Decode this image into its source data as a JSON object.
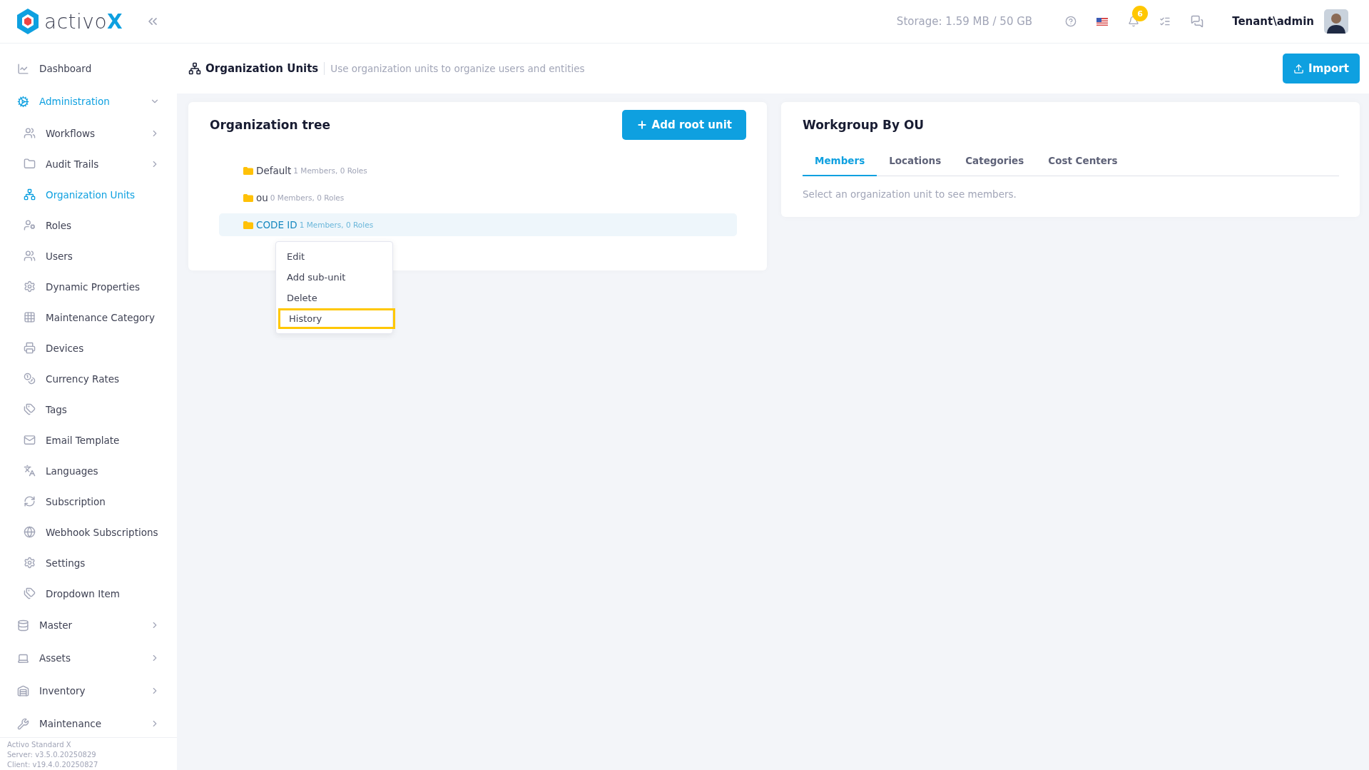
{
  "logo": {
    "word": "activo",
    "mark": "X"
  },
  "sidebar": {
    "items": [
      {
        "label": "Dashboard",
        "kind": "group",
        "selected": false
      },
      {
        "label": "Administration",
        "kind": "group",
        "selected": true,
        "expanded": true
      },
      {
        "label": "Workflows",
        "kind": "sub",
        "selected": false,
        "expanded": false
      },
      {
        "label": "Audit Trails",
        "kind": "sub",
        "selected": false,
        "expanded": false
      },
      {
        "label": "Organization Units",
        "kind": "sub",
        "selected": true
      },
      {
        "label": "Roles",
        "kind": "sub",
        "selected": false
      },
      {
        "label": "Users",
        "kind": "sub",
        "selected": false
      },
      {
        "label": "Dynamic Properties",
        "kind": "sub",
        "selected": false
      },
      {
        "label": "Maintenance Category",
        "kind": "sub",
        "selected": false
      },
      {
        "label": "Devices",
        "kind": "sub",
        "selected": false
      },
      {
        "label": "Currency Rates",
        "kind": "sub",
        "selected": false
      },
      {
        "label": "Tags",
        "kind": "sub",
        "selected": false
      },
      {
        "label": "Email Template",
        "kind": "sub",
        "selected": false
      },
      {
        "label": "Languages",
        "kind": "sub",
        "selected": false
      },
      {
        "label": "Subscription",
        "kind": "sub",
        "selected": false
      },
      {
        "label": "Webhook Subscriptions",
        "kind": "sub",
        "selected": false
      },
      {
        "label": "Settings",
        "kind": "sub",
        "selected": false
      },
      {
        "label": "Dropdown Item",
        "kind": "sub",
        "selected": false
      },
      {
        "label": "Master",
        "kind": "group",
        "selected": false,
        "expanded": false
      },
      {
        "label": "Assets",
        "kind": "group",
        "selected": false,
        "expanded": false
      },
      {
        "label": "Inventory",
        "kind": "group",
        "selected": false,
        "expanded": false
      },
      {
        "label": "Maintenance",
        "kind": "group",
        "selected": false,
        "expanded": false
      }
    ],
    "footer": [
      "Activo Standard X",
      "Server: v3.5.0.20250829",
      "Client: v19.4.0.20250827"
    ]
  },
  "header": {
    "storage": "Storage: 1.59 MB / 50 GB",
    "notification_count": "6",
    "user": "Tenant\\admin"
  },
  "page": {
    "title": "Organization Units",
    "description": "Use organization units to organize users and entities",
    "import_button": "Import"
  },
  "tree_card": {
    "title": "Organization tree",
    "add_button": "Add root unit",
    "nodes": [
      {
        "name": "Default",
        "info": "1 Members, 0 Roles",
        "selected": false
      },
      {
        "name": "ou",
        "info": "0 Members, 0 Roles",
        "selected": false
      },
      {
        "name": "CODE ID",
        "info": "1 Members, 0 Roles",
        "selected": true
      }
    ],
    "context_menu": [
      {
        "label": "Edit",
        "highlighted": false
      },
      {
        "label": "Add sub-unit",
        "highlighted": false
      },
      {
        "label": "Delete",
        "highlighted": false
      },
      {
        "label": "History",
        "highlighted": true
      }
    ]
  },
  "workgroup_card": {
    "title": "Workgroup By OU",
    "tabs": [
      {
        "label": "Members",
        "selected": true
      },
      {
        "label": "Locations",
        "selected": false
      },
      {
        "label": "Categories",
        "selected": false
      },
      {
        "label": "Cost Centers",
        "selected": false
      }
    ],
    "empty_text": "Select an organization unit to see members."
  }
}
